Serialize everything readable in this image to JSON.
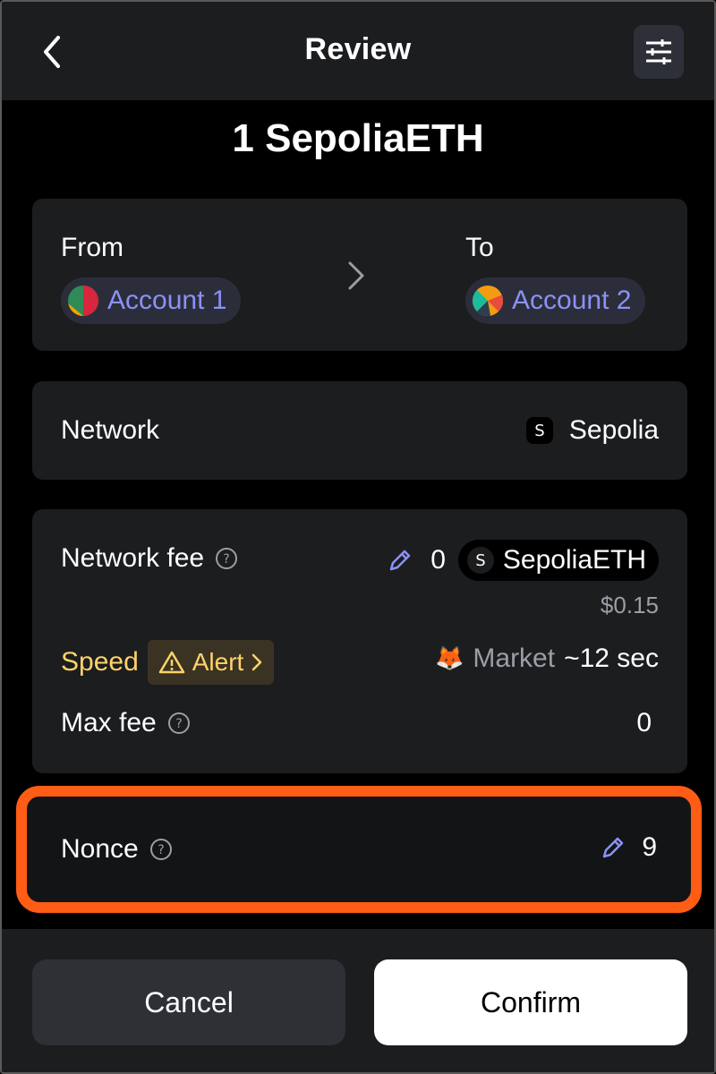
{
  "header": {
    "title": "Review"
  },
  "amount": "1 SepoliaETH",
  "accounts": {
    "from_label": "From",
    "from_account": "Account 1",
    "to_label": "To",
    "to_account": "Account 2"
  },
  "network": {
    "label": "Network",
    "badge_letter": "S",
    "value": "Sepolia"
  },
  "fees": {
    "network_fee_label": "Network fee",
    "network_fee_value": "0",
    "token_badge_letter": "S",
    "token_symbol": "SepoliaETH",
    "fiat_value": "$0.15",
    "speed_label": "Speed",
    "alert_label": "Alert",
    "speed_emoji": "🦊",
    "speed_mode": "Market",
    "speed_time": "~12 sec",
    "max_fee_label": "Max fee",
    "max_fee_value": "0"
  },
  "nonce": {
    "label": "Nonce",
    "value": "9"
  },
  "footer": {
    "cancel_label": "Cancel",
    "confirm_label": "Confirm"
  },
  "colors": {
    "accent": "#8b91f5",
    "warning": "#ffd36a",
    "highlight": "#ff5c16",
    "card": "#1c1d1f",
    "background": "#000000"
  },
  "icons": {
    "back": "chevron-left-icon",
    "settings": "sliders-icon",
    "arrow": "chevron-right-icon",
    "help": "question-circle-icon",
    "edit": "pencil-icon",
    "alert": "warning-triangle-icon"
  }
}
